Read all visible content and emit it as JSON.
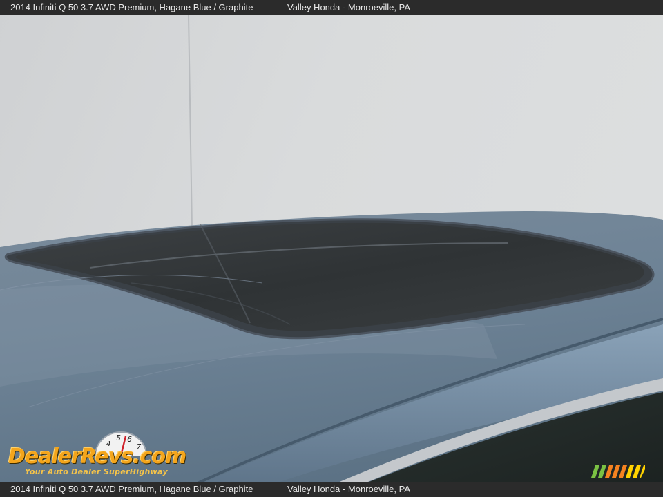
{
  "caption": {
    "vehicle": "2014 Infiniti Q 50 3.7 AWD Premium,   Hagane Blue / Graphite",
    "dealer": "Valley Honda - Monroeville, PA"
  },
  "watermark": {
    "logo_text": "DealerRevs.com",
    "tagline": "Your Auto Dealer SuperHighway"
  },
  "colors": {
    "caption_bg": "#2b2b2b",
    "car_paint": "#6a7f92",
    "wall": "#d6d8da",
    "logo": "#f4a51c"
  }
}
